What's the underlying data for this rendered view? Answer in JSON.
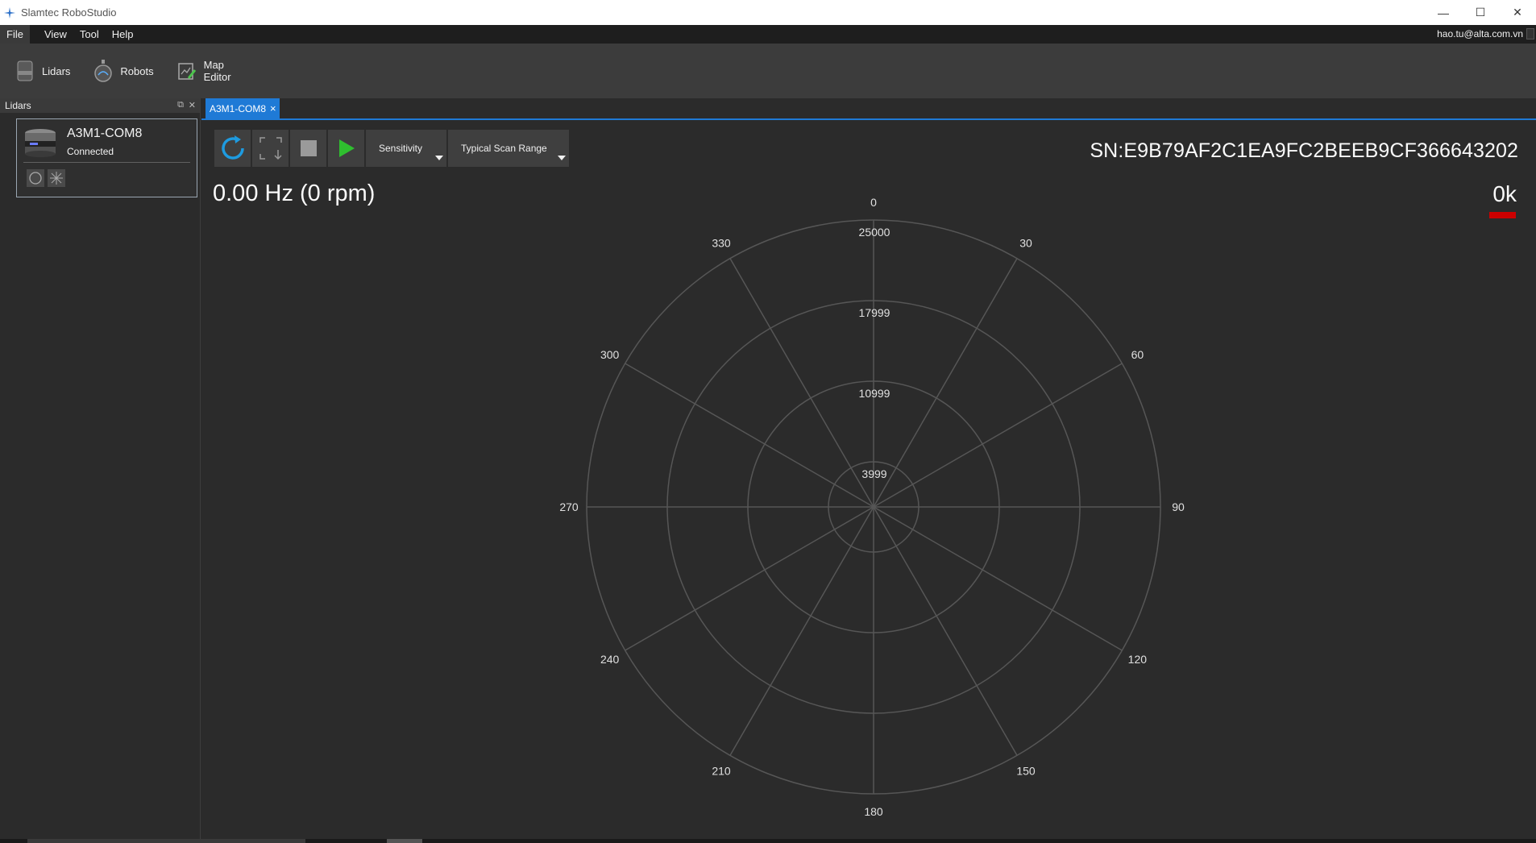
{
  "window": {
    "title": "Slamtec RoboStudio",
    "minimize": "—",
    "maximize": "☐",
    "close": "✕"
  },
  "menu": {
    "items": [
      "File",
      "View",
      "Tool",
      "Help"
    ],
    "active": "File",
    "user": "hao.tu@alta.com.vn"
  },
  "toolbar": {
    "lidars": "Lidars",
    "robots": "Robots",
    "map_editor_line1": "Map",
    "map_editor_line2": "Editor"
  },
  "side_panel": {
    "title": "Lidars",
    "device": {
      "name": "A3M1-COM8",
      "status": "Connected"
    }
  },
  "tab": {
    "label": "A3M1-COM8",
    "close": "×"
  },
  "scan": {
    "sensitivity_label": "Sensitivity",
    "scan_range_label": "Typical Scan Range",
    "serial": "SN:E9B79AF2C1EA9FC2BEEB9CF366643202",
    "frequency": "0.00 Hz (0 rpm)",
    "sample_count": "0k"
  },
  "polar": {
    "ring_labels": [
      "25000",
      "17999",
      "10999",
      "3999"
    ],
    "angle_labels": [
      "0",
      "30",
      "60",
      "90",
      "120",
      "150",
      "180",
      "210",
      "240",
      "270",
      "300",
      "330"
    ]
  },
  "colors": {
    "accent": "#1f7ad6",
    "play_green": "#2fbf2f",
    "refresh_blue": "#1e9be0",
    "alert_red": "#cc0000"
  }
}
